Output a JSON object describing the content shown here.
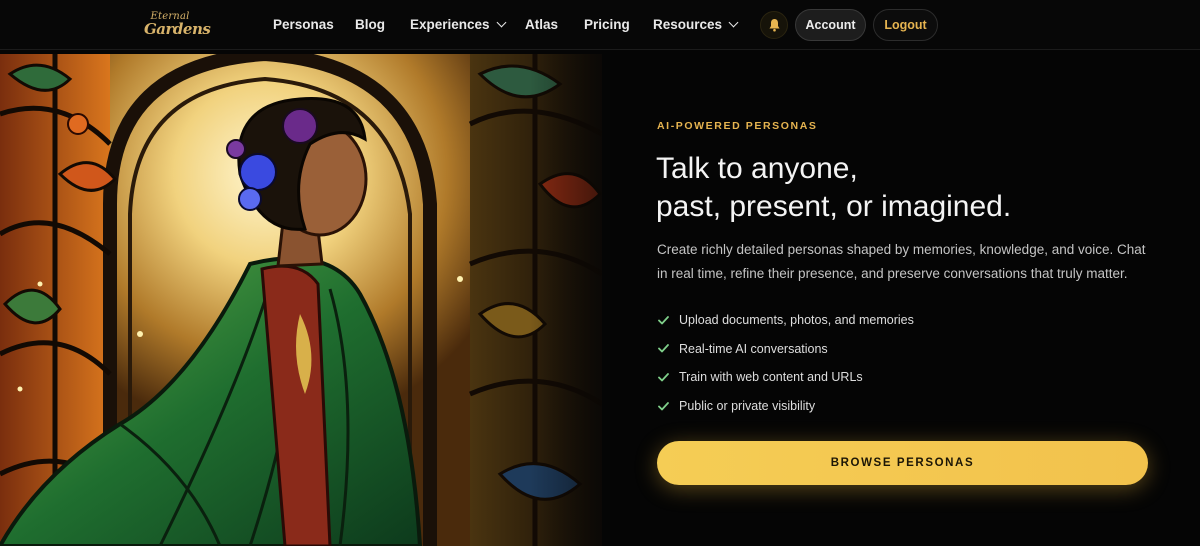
{
  "brand": {
    "logo_line1": "Eternal",
    "logo_line2": "Gardens"
  },
  "nav": {
    "items": [
      {
        "label": "Personas",
        "has_dropdown": false
      },
      {
        "label": "Blog",
        "has_dropdown": false
      },
      {
        "label": "Experiences",
        "has_dropdown": true
      },
      {
        "label": "Atlas",
        "has_dropdown": false
      },
      {
        "label": "Pricing",
        "has_dropdown": false
      },
      {
        "label": "Resources",
        "has_dropdown": true
      }
    ],
    "notification_icon": "bell-icon",
    "account_label": "Account",
    "logout_label": "Logout"
  },
  "hero": {
    "image_description": "stained-glass-woman-in-green-cloak",
    "eyebrow": "AI-POWERED PERSONAS",
    "headline_line1": "Talk to anyone,",
    "headline_line2": "past, present, or imagined.",
    "lead": "Create richly detailed personas shaped by memories, knowledge, and voice. Chat in real time, refine their presence, and preserve conversations that truly matter.",
    "features": [
      "Upload documents, photos, and memories",
      "Real-time AI conversations",
      "Train with web content and URLs",
      "Public or private visibility"
    ],
    "feature_icon": "check-icon",
    "cta_label": "BROWSE PERSONAS"
  },
  "colors": {
    "accent_gold": "#e6b450",
    "cta_gold": "#f4c752",
    "check_green": "#7fcf8a",
    "background": "#050505"
  }
}
